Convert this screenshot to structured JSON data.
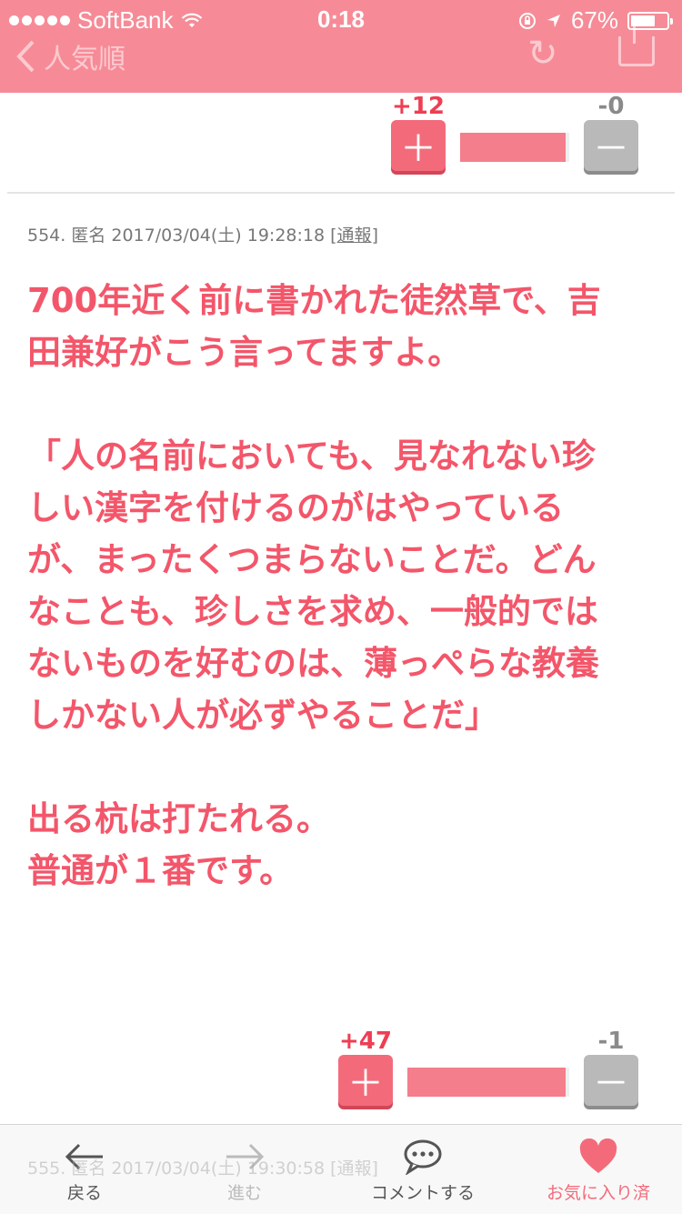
{
  "status_bar": {
    "carrier": "SoftBank",
    "time": "0:18",
    "battery": "67%",
    "battery_level": 0.67
  },
  "nav": {
    "back_label": "人気順",
    "reload_icon": "reload-icon",
    "share_icon": "share-icon"
  },
  "vote_top": {
    "plus": "+12",
    "minus": "-0",
    "ratio": 0.97
  },
  "comment": {
    "meta": "554. 匿名 2017/03/04(土) 19:28:18",
    "report": "通報",
    "body": "700年近く前に書かれた徒然草で、吉\n田兼好がこう言ってますよ。\n\n「人の名前においても、見なれない珍\nしい漢字を付けるのがはやっている\nが、まったくつまらないことだ。どん\nなことも、珍しさを求め、一般的では\nないものを好むのは、薄っぺらな教養\nしかない人が必ずやることだ」\n\n出る杭は打たれる。\n普通が１番です。"
  },
  "vote_bottom": {
    "plus": "+47",
    "minus": "-1",
    "ratio": 0.98
  },
  "next_comment_meta": "555. 匿名 2017/03/04(土) 19:30:58 [通報]",
  "tabbar": {
    "back": "戻る",
    "forward": "進む",
    "comment": "コメントする",
    "favorite": "お気に入り済"
  },
  "colors": {
    "accent": "#f68b97",
    "text_pink": "#f3566a",
    "plus": "#f36b7b",
    "minus": "#b9b9b9"
  }
}
